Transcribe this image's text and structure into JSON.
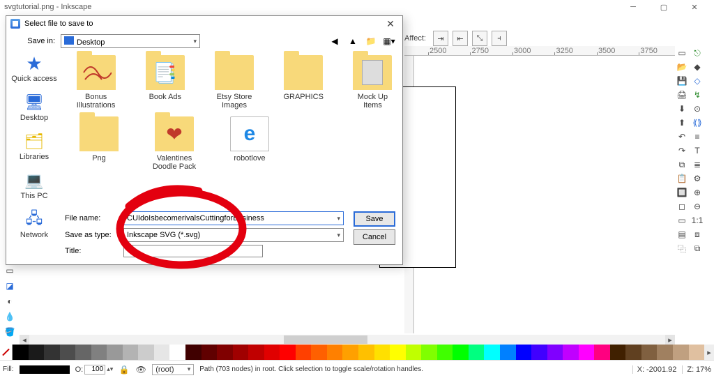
{
  "app": {
    "title": "svgtutorial.png - Inkscape"
  },
  "toolbar": {
    "affect_label": "Affect:"
  },
  "ruler": {
    "ticks": [
      "2500",
      "2750",
      "3000",
      "3250",
      "3500",
      "3750"
    ]
  },
  "statusbar": {
    "fill_label": "Fill:",
    "opacity_label": "O:",
    "opacity_value": "100",
    "layer_label": "(root)",
    "message": "Path (703 nodes) in root. Click selection to toggle scale/rotation handles.",
    "x_label": "X:",
    "x_value": "-2001.92",
    "zoom_label": "Z:",
    "zoom_value": "17%"
  },
  "palette_colors": [
    "#000000",
    "#1a1a1a",
    "#333333",
    "#4d4d4d",
    "#666666",
    "#808080",
    "#999999",
    "#b3b3b3",
    "#cccccc",
    "#e6e6e6",
    "#ffffff",
    "#400000",
    "#600000",
    "#800000",
    "#a00000",
    "#c00000",
    "#e00000",
    "#ff0000",
    "#ff4000",
    "#ff6000",
    "#ff8000",
    "#ffa000",
    "#ffc000",
    "#ffe000",
    "#ffff00",
    "#c0ff00",
    "#80ff00",
    "#40ff00",
    "#00ff00",
    "#00ff80",
    "#00ffff",
    "#0080ff",
    "#0000ff",
    "#4000ff",
    "#8000ff",
    "#c000ff",
    "#ff00ff",
    "#ff0080",
    "#402000",
    "#604020",
    "#806040",
    "#a08060",
    "#c0a080",
    "#e0c0a0"
  ],
  "dialog": {
    "title": "Select file to save to",
    "save_in_label": "Save in:",
    "save_in_value": "Desktop",
    "nav_items": [
      {
        "label": "Quick access",
        "icon": "star"
      },
      {
        "label": "Desktop",
        "icon": "desktop"
      },
      {
        "label": "Libraries",
        "icon": "libraries"
      },
      {
        "label": "This PC",
        "icon": "pc"
      },
      {
        "label": "Network",
        "icon": "network"
      }
    ],
    "files_row1": [
      {
        "label": "Bonus Illustrations",
        "kind": "folder",
        "overlay": "scribble"
      },
      {
        "label": "Book Ads",
        "kind": "folder",
        "overlay": "pages"
      },
      {
        "label": "Etsy Store Images",
        "kind": "folder",
        "overlay": ""
      },
      {
        "label": "GRAPHICS",
        "kind": "folder",
        "overlay": ""
      },
      {
        "label": "Mock Up Items",
        "kind": "folder",
        "overlay": "mockup"
      }
    ],
    "files_row2": [
      {
        "label": "Png",
        "kind": "folder",
        "overlay": ""
      },
      {
        "label": "Valentines Doodle Pack",
        "kind": "folder",
        "overlay": "heart"
      },
      {
        "label": "robotlove",
        "kind": "file",
        "overlay": "ie"
      }
    ],
    "filename_label": "File name:",
    "filename_value": "CUIdoIsbecomerivalsCuttingforBusiness",
    "saveastype_label": "Save as type:",
    "saveastype_value": "Inkscape SVG (*.svg)",
    "title_label": "Title:",
    "title_value": "",
    "save_btn": "Save",
    "cancel_btn": "Cancel"
  }
}
